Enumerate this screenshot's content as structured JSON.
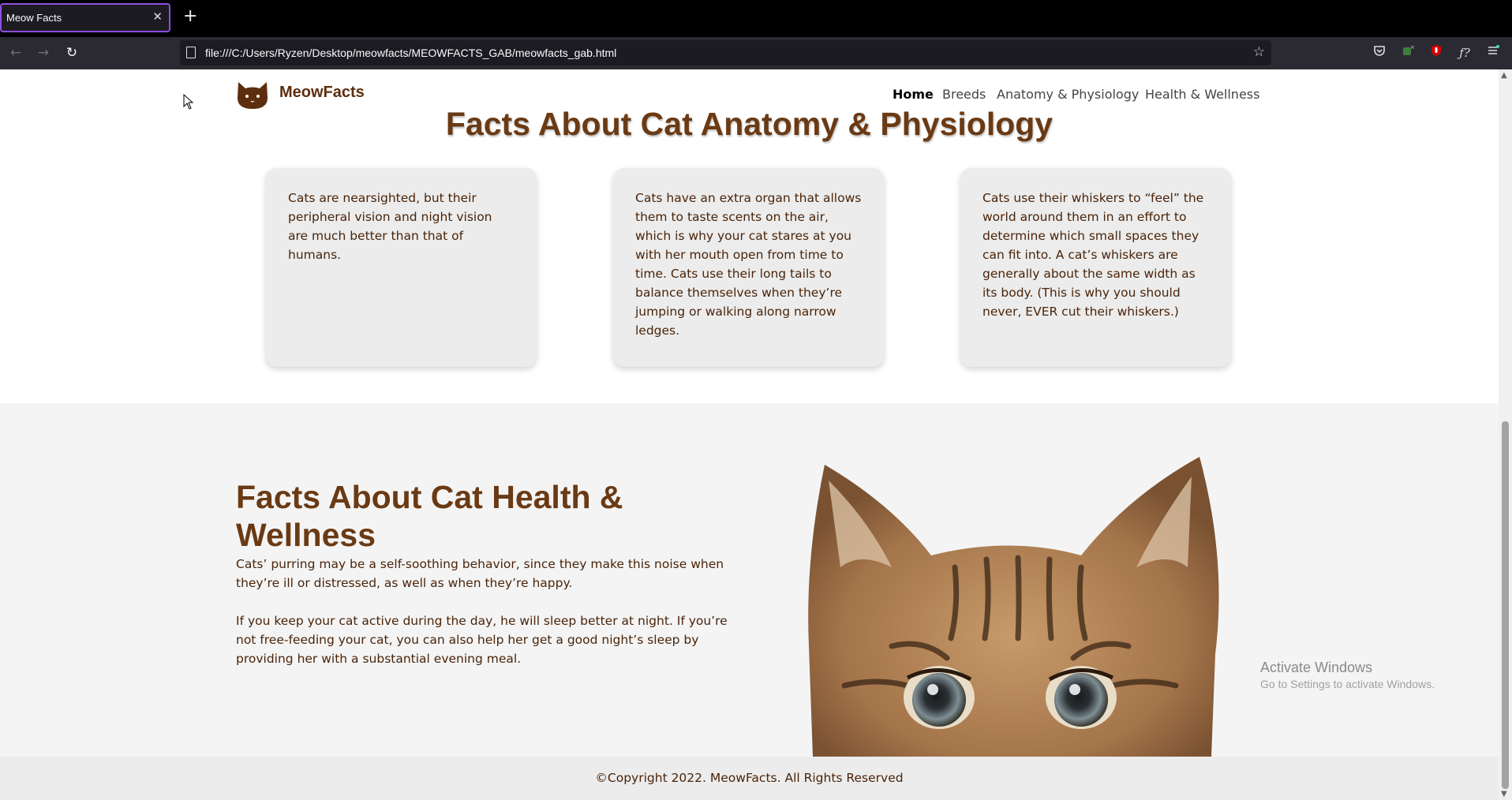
{
  "browser": {
    "tab_title": "Meow Facts",
    "tab_close": "✕",
    "new_tab": "+",
    "url": "file:///C:/Users/Ryzen/Desktop/meowfacts/MEOWFACTS_GAB/meowfacts_gab.html",
    "icons": [
      "back-icon",
      "forward-icon",
      "reload-icon",
      "bookmark-star-icon",
      "pocket-icon",
      "extension-icon",
      "ublock-icon",
      "formula-icon",
      "menu-icon"
    ]
  },
  "site": {
    "brand": "MeowFacts",
    "nav": [
      "Home",
      "Breeds",
      "Anatomy & Physiology",
      "Health & Wellness"
    ],
    "brand_color": "#5c2e0e"
  },
  "anatomy": {
    "title": "Facts About Cat Anatomy & Physiology",
    "cards": [
      "Cats are nearsighted, but their peripheral vision and night vision are much better than that of humans.",
      "Cats have an extra organ that allows them to taste scents on the air, which is why your cat stares at you with her mouth open from time to time. Cats use their long tails to balance themselves when they’re jumping or walking along narrow ledges.",
      "Cats use their whiskers to “feel” the world around them in an effort to determine which small spaces they can fit into. A cat’s whiskers are generally about the same width as its body. (This is why you should never, EVER cut their whiskers.)"
    ]
  },
  "health": {
    "title": "Facts About Cat Health & Wellness",
    "p1": "Cats’ purring may be a self-soothing behavior, since they make this noise when they’re ill or distressed, as well as when they’re happy.",
    "p2": "If you keep your cat active during the day, he will sleep better at night. If you’re not free-feeding your cat, you can also help her get a good night’s sleep by providing her with a substantial evening meal."
  },
  "footer": {
    "copyright": "©Copyright 2022. MeowFacts. All Rights Reserved"
  },
  "os_watermark": {
    "line1": "Activate Windows",
    "line2": "Go to Settings to activate Windows."
  }
}
